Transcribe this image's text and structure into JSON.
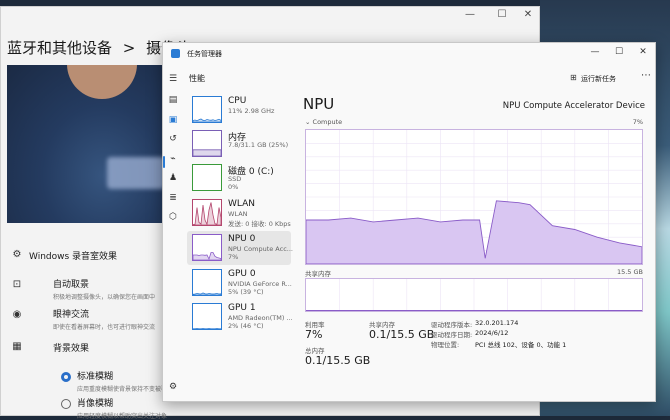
{
  "settings": {
    "breadcrumb_parent": "蓝牙和其他设备",
    "breadcrumb_sep": ">",
    "breadcrumb_current": "摄像头",
    "section_title": "Windows 录音室效果",
    "rows": [
      {
        "title": "自动取景",
        "sub": "积极地调整摄像头，以确保您在画面中"
      },
      {
        "title": "眼神交流",
        "sub": "即使在看着屏幕时，也可进行眼神交流"
      },
      {
        "title": "背景效果",
        "sub": ""
      }
    ],
    "options": [
      {
        "title": "标准模糊",
        "sub": "应用重度模糊使背景保持不变被覆盖"
      },
      {
        "title": "肖像模糊",
        "sub": "应用轻度模糊以帮助突出关注对象"
      }
    ]
  },
  "taskmgr": {
    "window_title": "任务管理器",
    "tab_title": "性能",
    "new_task": "运行新任务",
    "items": [
      {
        "name": "CPU",
        "sub": "11% 2.98 GHz",
        "color": "#2a7bd4",
        "points": [
          6,
          8,
          5,
          9,
          12,
          7,
          6,
          10,
          8,
          7,
          9,
          6,
          8,
          11,
          7
        ]
      },
      {
        "name": "内存",
        "sub": "7.8/31.1 GB (25%)",
        "color": "#7a5fb5",
        "points": [
          25,
          25,
          25,
          25,
          25,
          25,
          25,
          25,
          25,
          25,
          25,
          25,
          25,
          25,
          25
        ]
      },
      {
        "name": "磁盘 0 (C:)",
        "sub": "SSD",
        "sub2": "0%",
        "color": "#3a9a3a",
        "points": []
      },
      {
        "name": "WLAN",
        "sub": "WLAN",
        "sub2": "发送: 0 接收: 0 Kbps",
        "color": "#b4476e",
        "points": [
          2,
          2,
          70,
          10,
          4,
          80,
          20,
          3,
          60,
          90,
          40,
          5,
          3,
          70,
          30
        ]
      },
      {
        "name": "NPU 0",
        "sub": "NPU Compute Acc...",
        "sub2": "7%",
        "color": "#8a5cc8",
        "points": [
          20,
          20,
          20,
          18,
          20,
          20,
          19,
          20,
          4,
          30,
          30,
          15,
          10,
          8,
          6
        ]
      },
      {
        "name": "GPU 0",
        "sub": "NVIDIA GeForce R...",
        "sub2": "5% (39 °C)",
        "color": "#2a7bd4",
        "points": [
          3,
          4,
          6,
          5,
          4,
          8,
          5,
          4,
          6,
          5,
          4,
          5,
          6,
          4,
          5
        ]
      },
      {
        "name": "GPU 1",
        "sub": "AMD Radeon(TM) ...",
        "sub2": "2% (46 °C)",
        "color": "#2a7bd4",
        "points": [
          1,
          1,
          2,
          1,
          1,
          2,
          1,
          1,
          2,
          1,
          1,
          1,
          2,
          1,
          1
        ]
      }
    ],
    "main": {
      "title": "NPU",
      "device": "NPU Compute Accelerator Device",
      "chart_label": "Compute",
      "chart_max": "7%",
      "time_label": "60 秒",
      "shared_label": "共享内存",
      "shared_max": "15.5 GB",
      "stats": {
        "util_label": "利用率",
        "util_value": "7%",
        "shared_label": "共享内存",
        "shared_value": "0.1/15.5 GB",
        "total_label": "总内存",
        "total_value": "0.1/15.5 GB"
      },
      "info": [
        {
          "k": "驱动程序版本:",
          "v": "32.0.201.174"
        },
        {
          "k": "驱动程序日期:",
          "v": "2024/6/12"
        },
        {
          "k": "物理位置:",
          "v": "PCI 总线 102、设备 0、功能 1"
        }
      ]
    },
    "chart_data": {
      "type": "area",
      "title": "Compute",
      "ylabel": "",
      "ylim": [
        0,
        7
      ],
      "x": [
        0,
        4,
        8,
        12,
        16,
        20,
        24,
        28,
        31,
        32,
        34,
        38,
        40,
        44,
        48,
        52,
        56,
        60
      ],
      "values": [
        2.3,
        2.3,
        2.4,
        2.2,
        2.3,
        2.4,
        2.2,
        2.3,
        2.3,
        0.3,
        3.3,
        3.2,
        3.1,
        2.0,
        1.8,
        1.4,
        1.1,
        0.9
      ],
      "color": "#d9c6f2",
      "stroke": "#8a5cc8"
    }
  }
}
